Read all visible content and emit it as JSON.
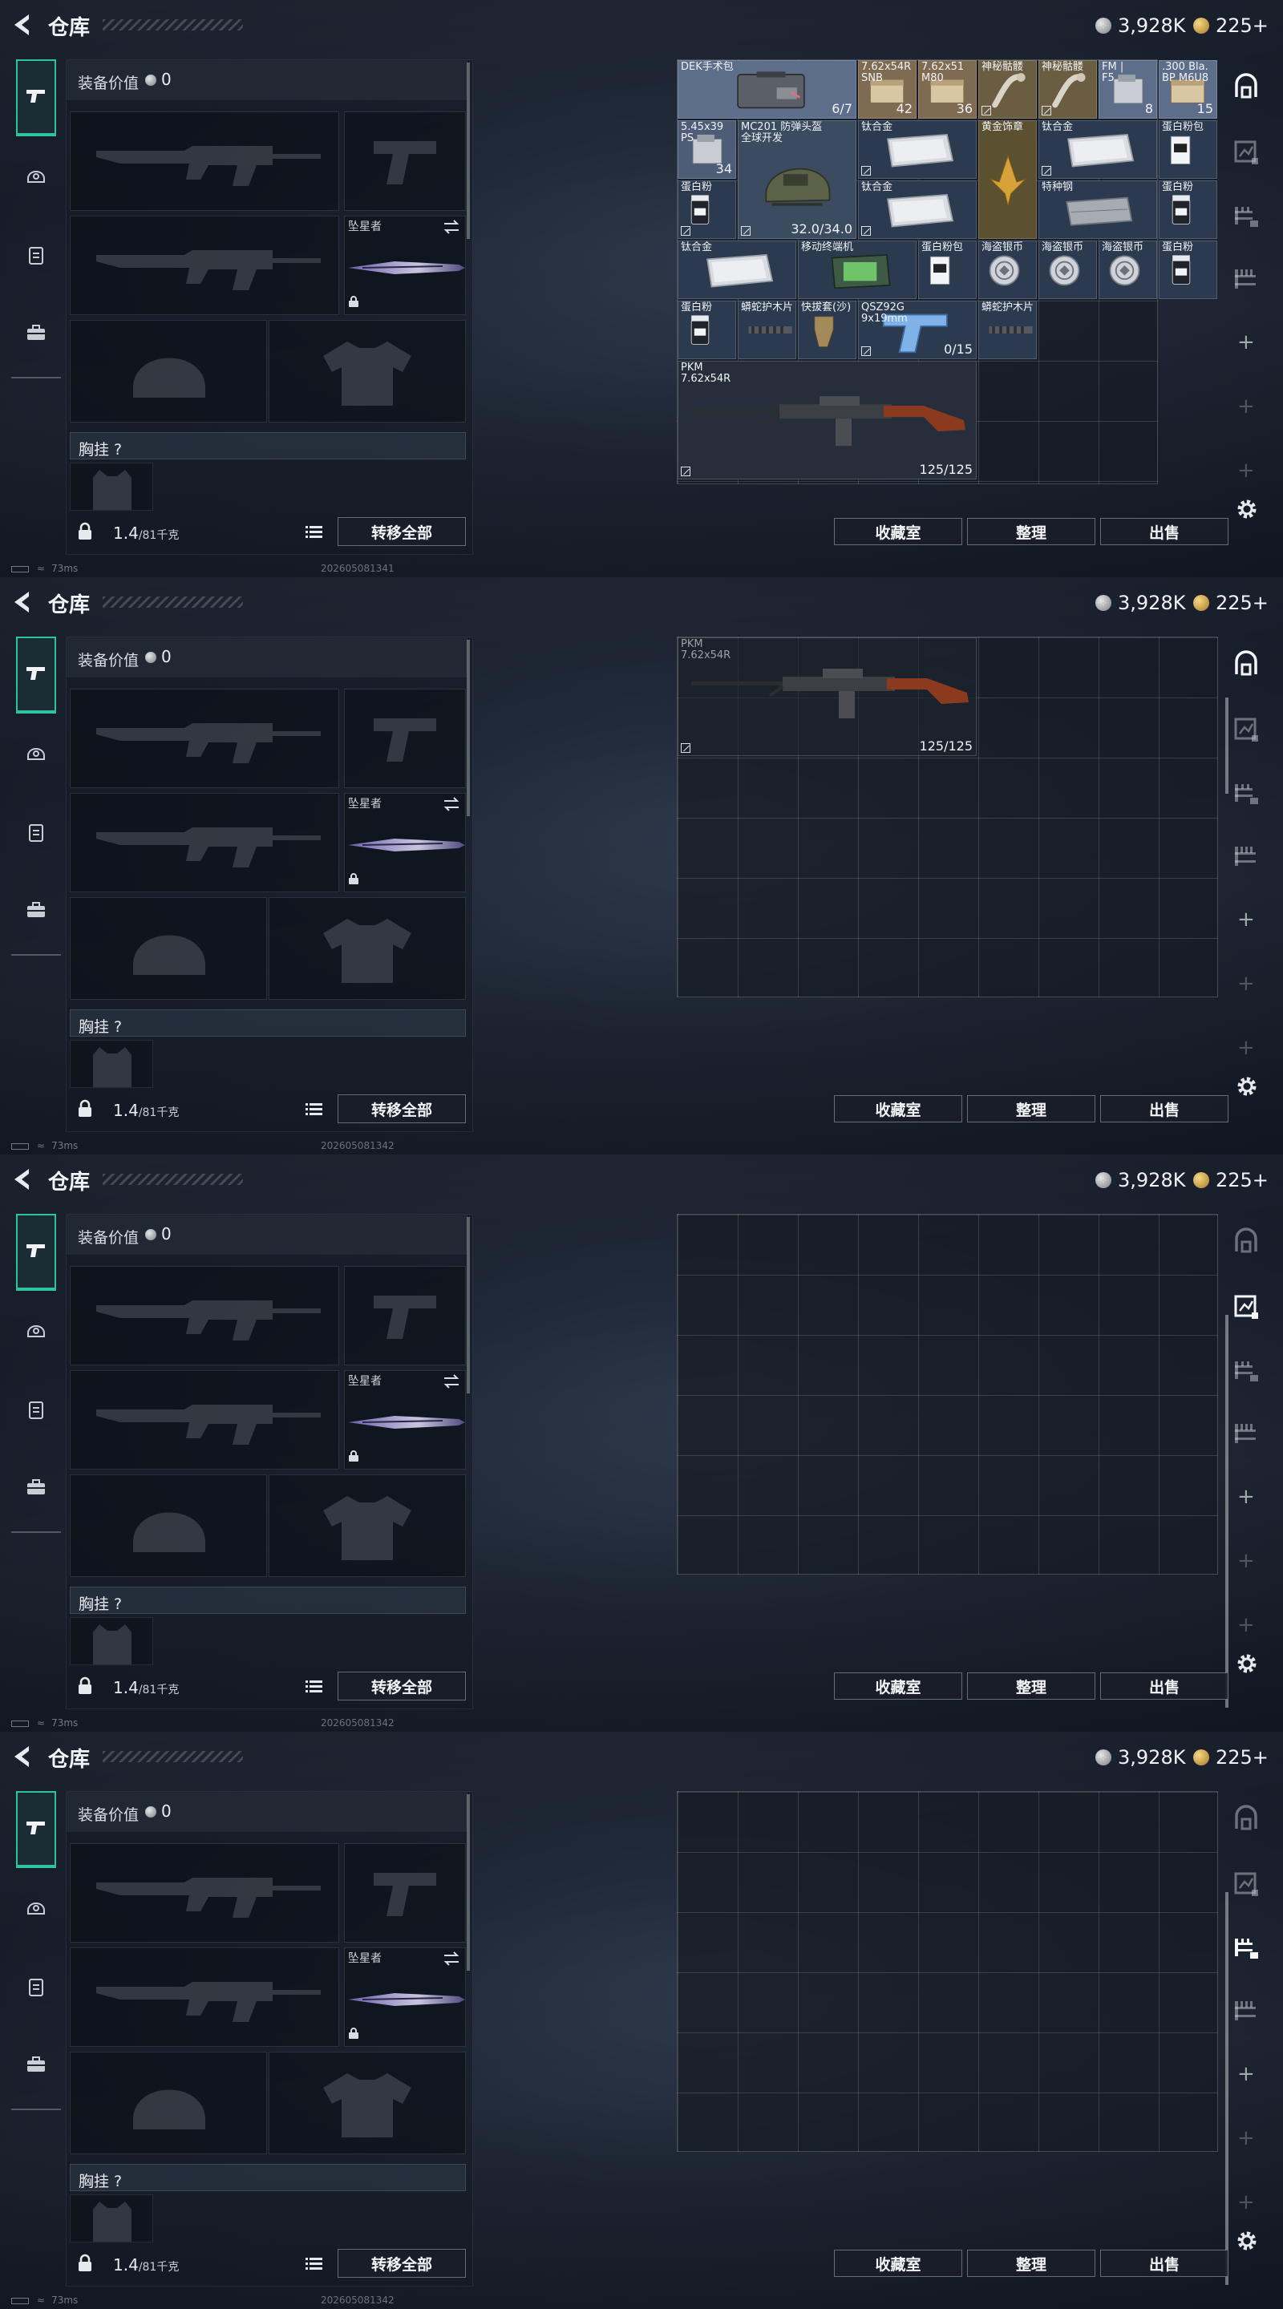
{
  "header": {
    "title": "仓库",
    "silver_amount": "3,928K",
    "gold_amount": "225+"
  },
  "equipment": {
    "value_label": "装备价值",
    "value": "0",
    "melee_name": "坠星者",
    "vest_label": "胸挂 ?",
    "weight_value": "1.4",
    "weight_unit": "/81千克",
    "transfer_all_label": "转移全部"
  },
  "stash_buttons": {
    "favorites_label": "收藏室",
    "sort_label": "整理",
    "sell_label": "出售"
  },
  "status_bar": {
    "ping": "73ms",
    "stamps": [
      "202605081341",
      "202605081342",
      "202605081342",
      "202605081342"
    ]
  },
  "stash_items": [
    {
      "name": "DEK手术包",
      "count": "6/7"
    },
    {
      "name": "7.62x54R\nSNB",
      "count": "42"
    },
    {
      "name": "7.62x51\nM80",
      "count": "36"
    },
    {
      "name": "神秘骷髅",
      "count": ""
    },
    {
      "name": "神秘骷髅",
      "count": ""
    },
    {
      "name": "FM |\nF5",
      "count": "8"
    },
    {
      "name": ".300 Bla.\nBP M6U8",
      "count": "15"
    },
    {
      "name": "5.45x39\nPS",
      "count": "34"
    },
    {
      "name": "MC201 防弹头盔\n全球开发",
      "count": "32.0/34.0"
    },
    {
      "name": "钛合金",
      "count": ""
    },
    {
      "name": "黄金饰章",
      "count": ""
    },
    {
      "name": "钛合金",
      "count": ""
    },
    {
      "name": "蛋白粉包",
      "count": ""
    },
    {
      "name": "蛋白粉",
      "count": ""
    },
    {
      "name": "钛合金",
      "count": ""
    },
    {
      "name": "特种钢",
      "count": ""
    },
    {
      "name": "蛋白粉",
      "count": ""
    },
    {
      "name": "钛合金",
      "count": ""
    },
    {
      "name": "移动终端机",
      "count": ""
    },
    {
      "name": "蛋白粉包",
      "count": ""
    },
    {
      "name": "海盗银币",
      "count": ""
    },
    {
      "name": "海盗银币",
      "count": ""
    },
    {
      "name": "海盗银币",
      "count": ""
    },
    {
      "name": "蛋白粉",
      "count": ""
    },
    {
      "name": "蛋白粉",
      "count": ""
    },
    {
      "name": "蟒蛇护木片",
      "count": ""
    },
    {
      "name": "快拔套(沙)",
      "count": ""
    },
    {
      "name": "QSZ92G\n9x19mm",
      "count": "0/15"
    },
    {
      "name": "蟒蛇护木片",
      "count": ""
    },
    {
      "name": "PKM\n7.62x54R",
      "count": "125/125"
    }
  ],
  "pkm_item": {
    "name": "PKM\n7.62x54R",
    "count": "125/125"
  },
  "colors": {
    "accent": "#2fc29e",
    "background": "#1a2230"
  }
}
